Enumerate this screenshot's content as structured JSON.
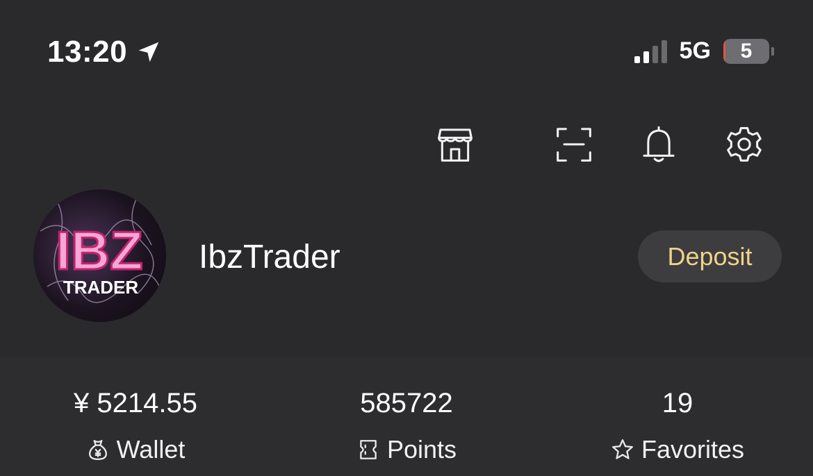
{
  "status_bar": {
    "time": "13:20",
    "network": "5G",
    "battery_level": "5",
    "battery_fraction": 0.05,
    "signal_bars_active": 2,
    "signal_bars_total": 4,
    "icons": [
      "location-arrow-icon",
      "signal-icon",
      "battery-icon"
    ]
  },
  "toolbar": {
    "icons": [
      "store-icon",
      "scan-icon",
      "bell-icon",
      "gear-icon"
    ]
  },
  "profile": {
    "avatar_text_main": "IBZ",
    "avatar_text_sub": "TRADER",
    "username": "IbzTrader",
    "deposit_label": "Deposit"
  },
  "stats": {
    "wallet": {
      "value": "¥ 5214.55",
      "label": "Wallet",
      "icon": "money-bag-icon"
    },
    "points": {
      "value": "585722",
      "label": "Points",
      "icon": "ticket-icon"
    },
    "favorites": {
      "value": "19",
      "label": "Favorites",
      "icon": "star-icon"
    }
  },
  "colors": {
    "background": "#2a2a2c",
    "deposit_text": "#f0d28a",
    "battery_low": "#e0524a"
  }
}
